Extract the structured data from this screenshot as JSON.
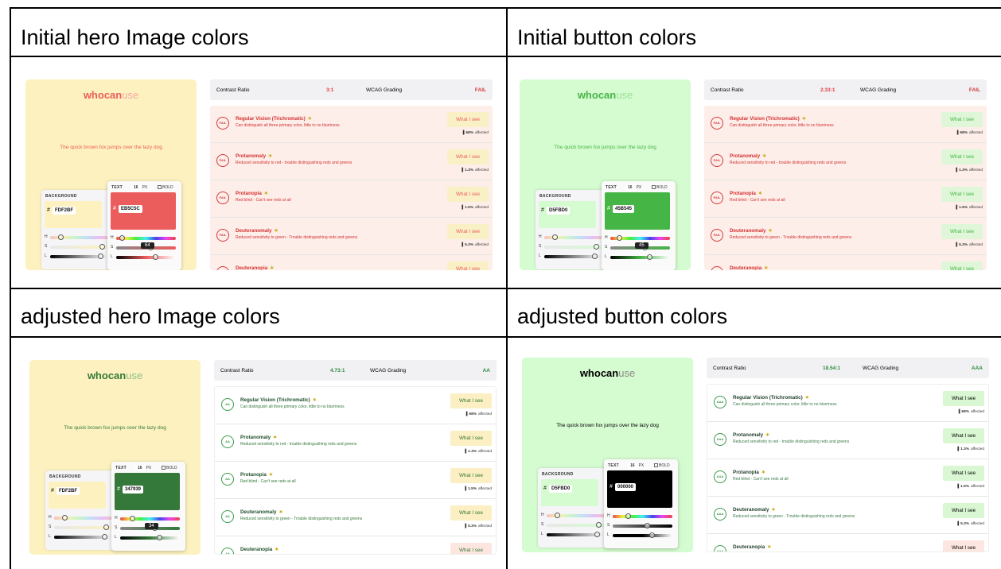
{
  "cells": [
    {
      "title": "Initial hero Image colors",
      "hero_bg": "#FDF2BF",
      "logo_color": "#EB5C5C",
      "logo_use_color": "#f7a6a6",
      "quick_color": "#EB5C5C",
      "bg_hex": "FDF2BF",
      "text_hex": "EB5C5C",
      "text_swatch": "#EB5C5C",
      "tooltip": "64",
      "contrast_ratio": "3:1",
      "ratio_color": "#e33b3b",
      "grade": "FAIL",
      "grade_color": "#d33a3a",
      "list_bg": "#fdeee9",
      "badge_label": "FAIL",
      "badge_color": "#d63a3a",
      "title_color": "#d33030",
      "desc_color": "#d33030",
      "wis_bg": "#faf0c6",
      "wis_color": "#EB5C5C"
    },
    {
      "title": "Initial button colors",
      "hero_bg": "#D5FBD0",
      "logo_color": "#45B545",
      "logo_use_color": "#9be09b",
      "quick_color": "#45B545",
      "bg_hex": "D5FBD0",
      "text_hex": "45B545",
      "text_swatch": "#45B545",
      "tooltip": "45",
      "contrast_ratio": "2.33:1",
      "ratio_color": "#e33b3b",
      "grade": "FAIL",
      "grade_color": "#d33a3a",
      "list_bg": "#fdeee9",
      "badge_label": "FAIL",
      "badge_color": "#d63a3a",
      "title_color": "#d33030",
      "desc_color": "#d33030",
      "wis_bg": "#dff7d8",
      "wis_color": "#45B545"
    },
    {
      "title": "adjusted hero Image colors",
      "hero_bg": "#FDF2BF",
      "logo_color": "#347939",
      "logo_use_color": "#8dbf8f",
      "quick_color": "#347939",
      "bg_hex": "FDF2BF",
      "text_hex": "347939",
      "text_swatch": "#347939",
      "tooltip": "34",
      "contrast_ratio": "4.73:1",
      "ratio_color": "#2f8a3e",
      "grade": "AA",
      "grade_color": "#2f8a3e",
      "list_bg": "#ffffff",
      "badge_label": "AA",
      "badge_color": "#3a9a4a",
      "title_color": "#1f4f2a",
      "desc_color": "#347939",
      "wis_bg": "#fbefc3",
      "wis_color": "#347939"
    },
    {
      "title": "adjusted button colors",
      "hero_bg": "#D5FBD0",
      "logo_color": "#000000",
      "logo_use_color": "#8a8a8a",
      "quick_color": "#000000",
      "bg_hex": "D5FBD0",
      "text_hex": "000000",
      "text_swatch": "#000000",
      "tooltip": "",
      "contrast_ratio": "18.54:1",
      "ratio_color": "#2f8a3e",
      "grade": "AAA",
      "grade_color": "#2f8a3e",
      "list_bg": "#ffffff",
      "badge_label": "AAA",
      "badge_color": "#3a9a4a",
      "title_color": "#1f3f2a",
      "desc_color": "#3a7a4a",
      "wis_bg": "#d8f7d2",
      "wis_color": "#000000"
    }
  ],
  "labels": {
    "logo_who": "who",
    "logo_can": "can",
    "logo_use": "use",
    "quick": "The quick brown fox jumps over the lazy dog",
    "background": "BACKGROUND",
    "text": "TEXT",
    "size": "16",
    "px": "PX",
    "bold": "BOLD",
    "hash": "#",
    "h": "H",
    "s": "S",
    "l": "L",
    "contrast_ratio": "Contrast Ratio",
    "wcag_grading": "WCAG Grading",
    "what_i_see": "What I see",
    "affected": "affected"
  },
  "rows": [
    {
      "title": "Regular Vision (Trichromatic)",
      "desc": "Can distinguish all three primary color, little to no blurriness",
      "pct": "68%"
    },
    {
      "title": "Protanomaly",
      "desc": "Reduced sensitivity to red - trouble distinguishing reds and greens",
      "pct": "1.3%"
    },
    {
      "title": "Protanopia",
      "desc": "Red blind - Can't see reds at all",
      "pct": "1.5%"
    },
    {
      "title": "Deuteranomaly",
      "desc": "Reduced sensitivity to green - Trouble distinguishing reds and greens",
      "pct": "5.3%"
    },
    {
      "title": "Deuteranopia",
      "desc": "",
      "pct": ""
    }
  ]
}
